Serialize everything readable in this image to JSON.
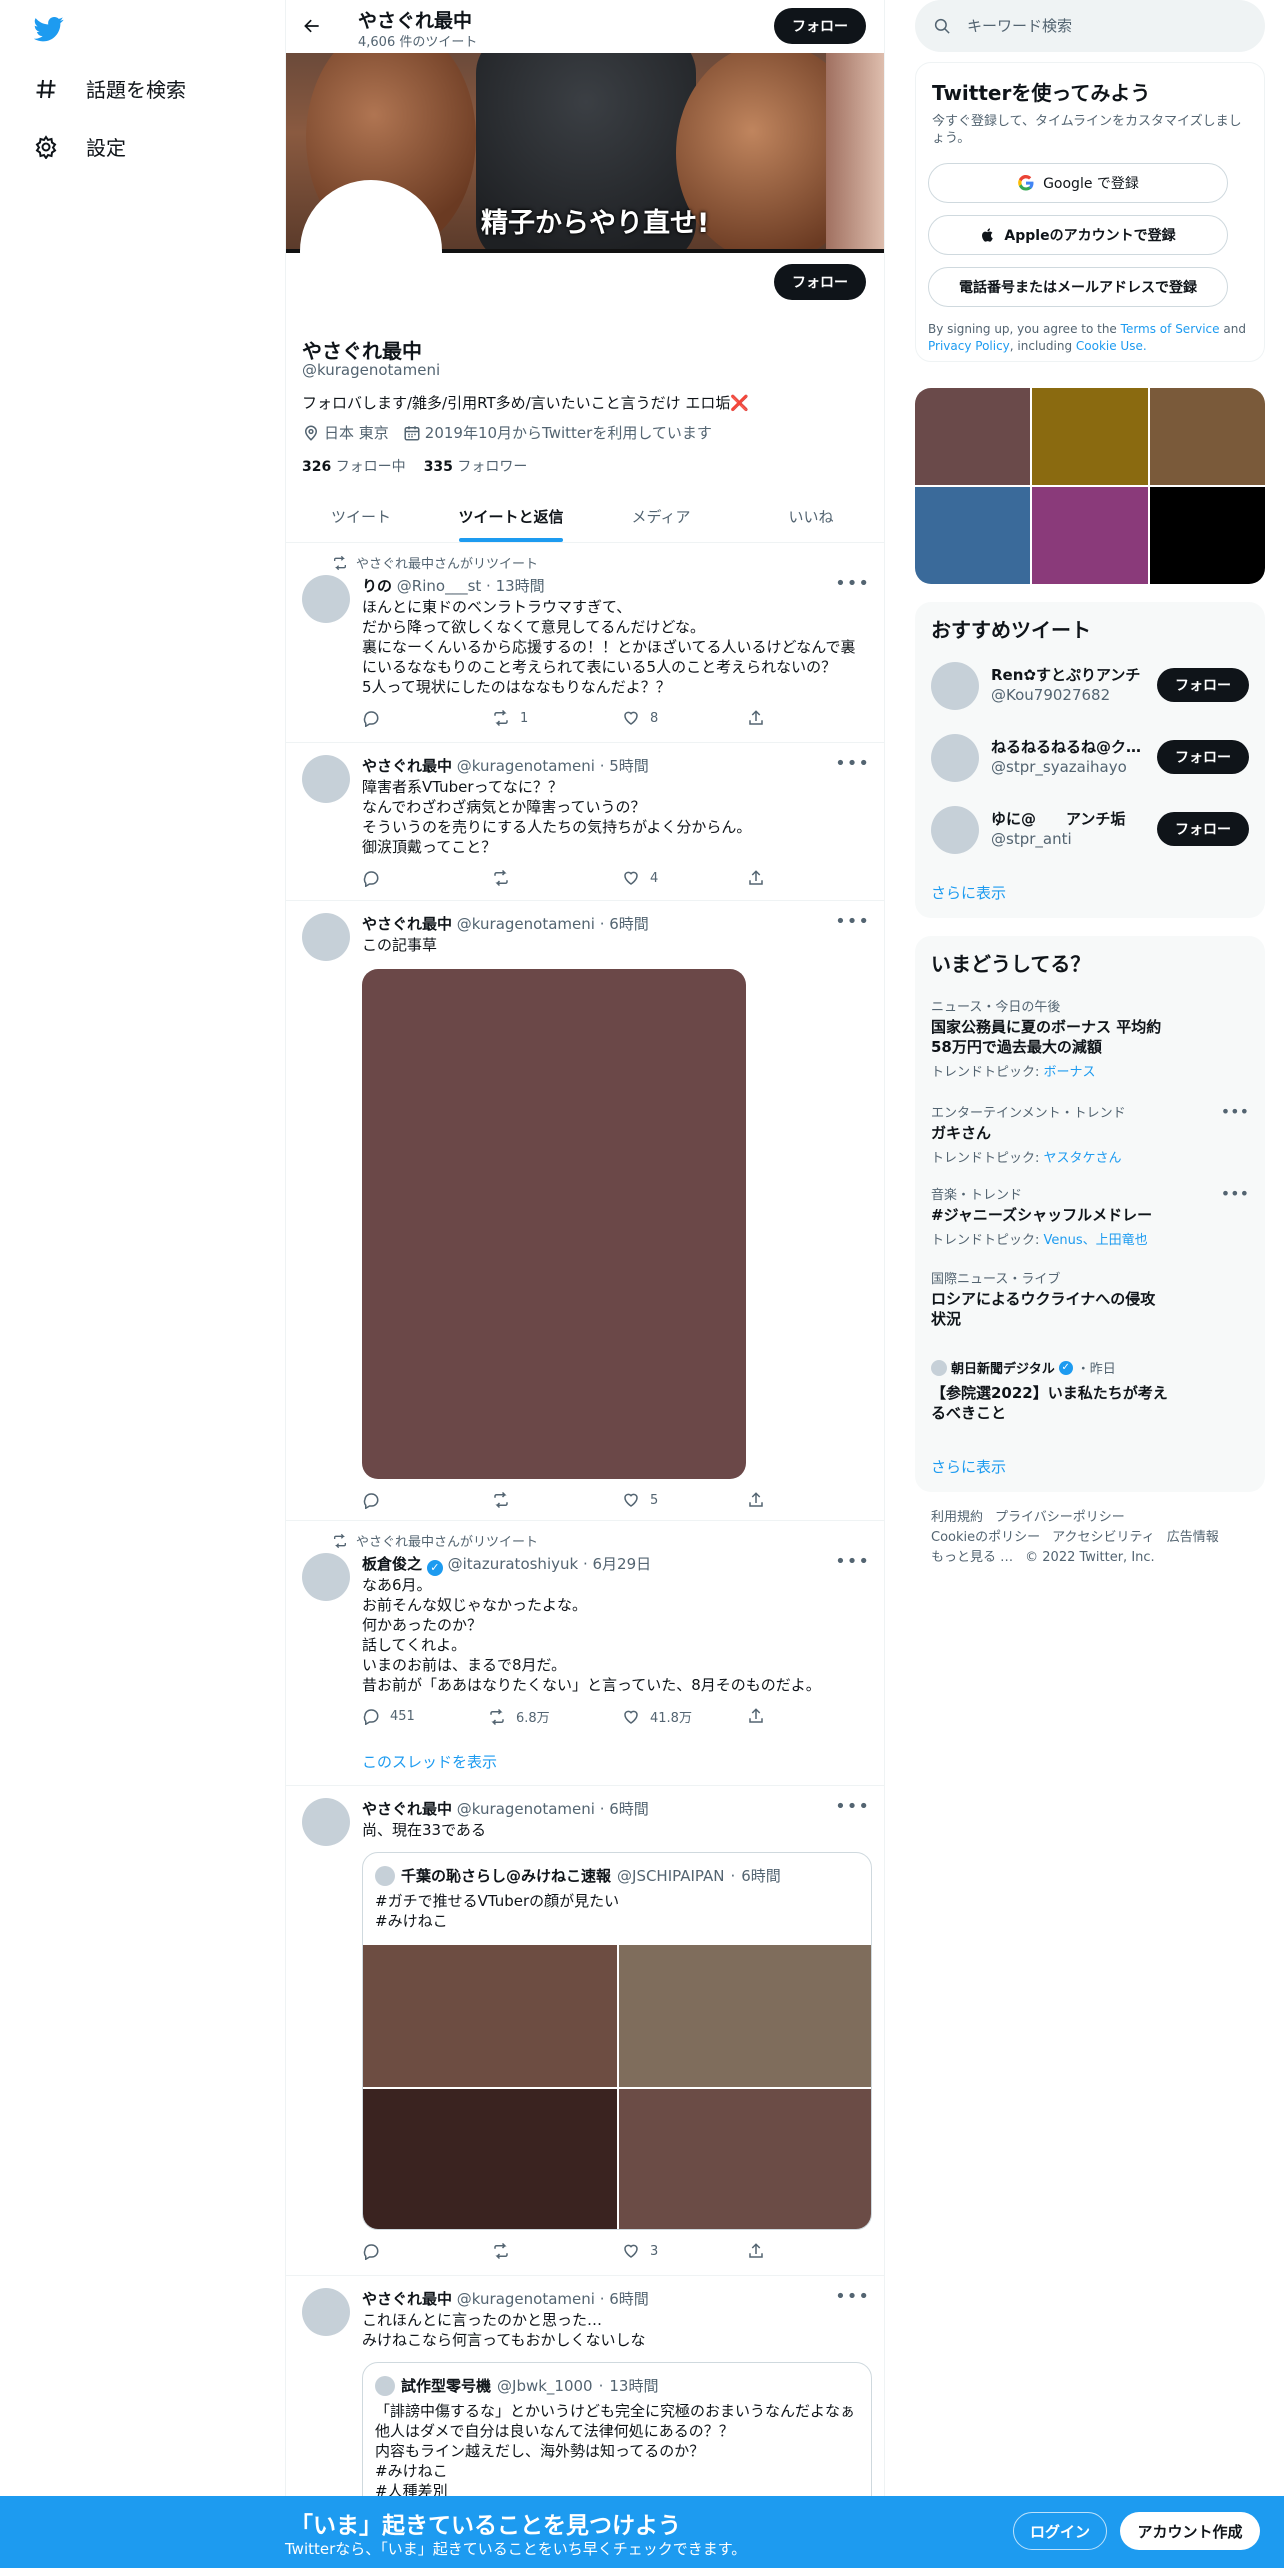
{
  "nav": {
    "explore": "話題を検索",
    "settings": "設定"
  },
  "header": {
    "name": "やさぐれ最中",
    "count": "4,606 件のツイート",
    "follow": "フォロー"
  },
  "banner": {
    "caption": "精子からやり直せ!"
  },
  "profile": {
    "name": "やさぐれ最中",
    "handle": "@kuragenotameni",
    "bio": "フォロバします/雑多/引用RT多め/言いたいこと言うだけ エロ垢❌",
    "location": "日本 東京",
    "joined": "2019年10月からTwitterを利用しています",
    "following_count": "326",
    "following_label": "フォロー中",
    "followers_count": "335",
    "followers_label": "フォロワー",
    "follow": "フォロー"
  },
  "tabs": [
    "ツイート",
    "ツイートと返信",
    "メディア",
    "いいね"
  ],
  "tweets": [
    {
      "rt": "やさぐれ最中さんがリツイート",
      "name": "りの",
      "handle": "@Rino___st",
      "time": "13時間",
      "text": "ほんとに東ドのベンラトラウマすぎて、\nだから降って欲しくなくて意見してるんだけどな。\n裏になーくんいるから応援するの！！とかほざいてる人いるけどなんで裏\nにいるななもりのこと考えられて表にいる5人のこと考えられないの？\n5人って現状にしたのはななもりなんだよ？？",
      "reply": "",
      "retweet": "1",
      "like": "8"
    },
    {
      "name": "やさぐれ最中",
      "handle": "@kuragenotameni",
      "time": "5時間",
      "text": "障害者系VTuberってなに？？\nなんでわざわざ病気とか障害っていうの？\nそういうのを売りにする人たちの気持ちがよく分からん。\n御涙頂戴ってこと？",
      "reply": "",
      "retweet": "",
      "like": "4"
    },
    {
      "name": "やさぐれ最中",
      "handle": "@kuragenotameni",
      "time": "6時間",
      "text": "この記事草",
      "reply": "",
      "retweet": "",
      "like": "5"
    },
    {
      "rt": "やさぐれ最中さんがリツイート",
      "name": "板倉俊之",
      "handle": "@itazuratoshiyuk",
      "time": "6月29日",
      "text": "なあ6月。\nお前そんな奴じゃなかったよな。\n何かあったのか？\n話してくれよ。\nいまのお前は、まるで8月だ。\n昔お前が「ああはなりたくない」と言っていた、8月そのものだよ。",
      "reply": "451",
      "retweet": "6.8万",
      "like": "41.8万",
      "thread": "このスレッドを表示"
    },
    {
      "name": "やさぐれ最中",
      "handle": "@kuragenotameni",
      "time": "6時間",
      "text": "尚、現在33である",
      "reply": "",
      "retweet": "",
      "like": "3",
      "quote": {
        "name": "千葉の恥さらし@みけねこ速報",
        "handle": "@JSCHIPAIPAN",
        "time": "6時間",
        "text": "#ガチで推せるVTuberの顔が見たい\n#みけねこ"
      }
    },
    {
      "name": "やさぐれ最中",
      "handle": "@kuragenotameni",
      "time": "6時間",
      "text": "これほんとに言ったのかと思った…\nみけねこなら何言ってもおかしくないしな",
      "quote": {
        "name": "試作型零号機",
        "handle": "@Jbwk_1000",
        "time": "13時間",
        "text": "「誹謗中傷するな」とかいうけども完全に究極のおまいうなんだよなぁ\n他人はダメで自分は良いなんて法律何処にあるの？？\n内容もライン越えだし、海外勢は知ってるのか？\n#みけねこ\n#人種差別"
      }
    }
  ],
  "colors": {
    "article_image": "#6b4848",
    "q1": "#6d4d42",
    "q2": "#7f6d5c",
    "q3": "#3a2320",
    "q4": "#6b4c46"
  },
  "search": {
    "placeholder": "キーワード検索"
  },
  "signup": {
    "title": "Twitterを使ってみよう",
    "sub": "今すぐ登録して、タイムラインをカスタマイズしましょう。",
    "google": "Google で登録",
    "apple": "Appleのアカウントで登録",
    "phone": "電話番号またはメールアドレスで登録",
    "terms_prefix": "By signing up, you agree to the",
    "terms_link": "Terms of Service",
    "terms_and": "and",
    "privacy_link": "Privacy Policy",
    "terms_including": ", including",
    "cookie_link": "Cookie Use."
  },
  "media_colors": [
    "#6a4a4a",
    "#8a6a10",
    "#7a5a3a",
    "#3a6a9a",
    "#8a3a7a",
    "#000000"
  ],
  "reco": {
    "title": "おすすめツイート",
    "users": [
      {
        "name": "Ren✿すとぷりアンチ",
        "handle": "@Kou79027682"
      },
      {
        "name": "ねるねるねるね@ク…",
        "handle": "@stpr_syazaihayo"
      },
      {
        "name": "ゆに@　　アンチ垢",
        "handle": "@stpr_anti"
      }
    ],
    "follow": "フォロー",
    "more": "さらに表示"
  },
  "trends": {
    "title": "いまどうしてる？",
    "items": [
      {
        "cat": "ニュース・今日の午後",
        "title": "国家公務員に夏のボーナス 平均約\n58万円で過去最大の減額",
        "topic_label": "トレンドトピック:",
        "topic": "ボーナス"
      },
      {
        "cat": "エンターテインメント・トレンド",
        "title": "ガキさん",
        "topic_label": "トレンドトピック:",
        "topic": "ヤスタケさん"
      },
      {
        "cat": "音楽・トレンド",
        "title": "#ジャニーズシャッフルメドレー",
        "topic_label": "トレンドトピック:",
        "topic": "Venus、上田竜也"
      },
      {
        "cat": "国際ニュース・ライブ",
        "title": "ロシアによるウクライナへの侵攻\n状況"
      },
      {
        "source": "朝日新聞デジタル",
        "time": "・昨日",
        "title": "【参院選2022】いま私たちが考え\nるべきこと"
      }
    ],
    "more": "さらに表示"
  },
  "footer": {
    "l1": [
      "利用規約",
      "プライバシーポリシー"
    ],
    "l2": [
      "Cookieのポリシー",
      "アクセシビリティ",
      "広告情報"
    ],
    "l3": [
      "もっと見る …",
      "© 2022 Twitter, Inc."
    ]
  },
  "bottom": {
    "title": "「いま」起きていることを見つけよう",
    "sub": "Twitterなら、「いま」起きていることをいち早くチェックできます。",
    "login": "ログイン",
    "signup": "アカウント作成"
  }
}
